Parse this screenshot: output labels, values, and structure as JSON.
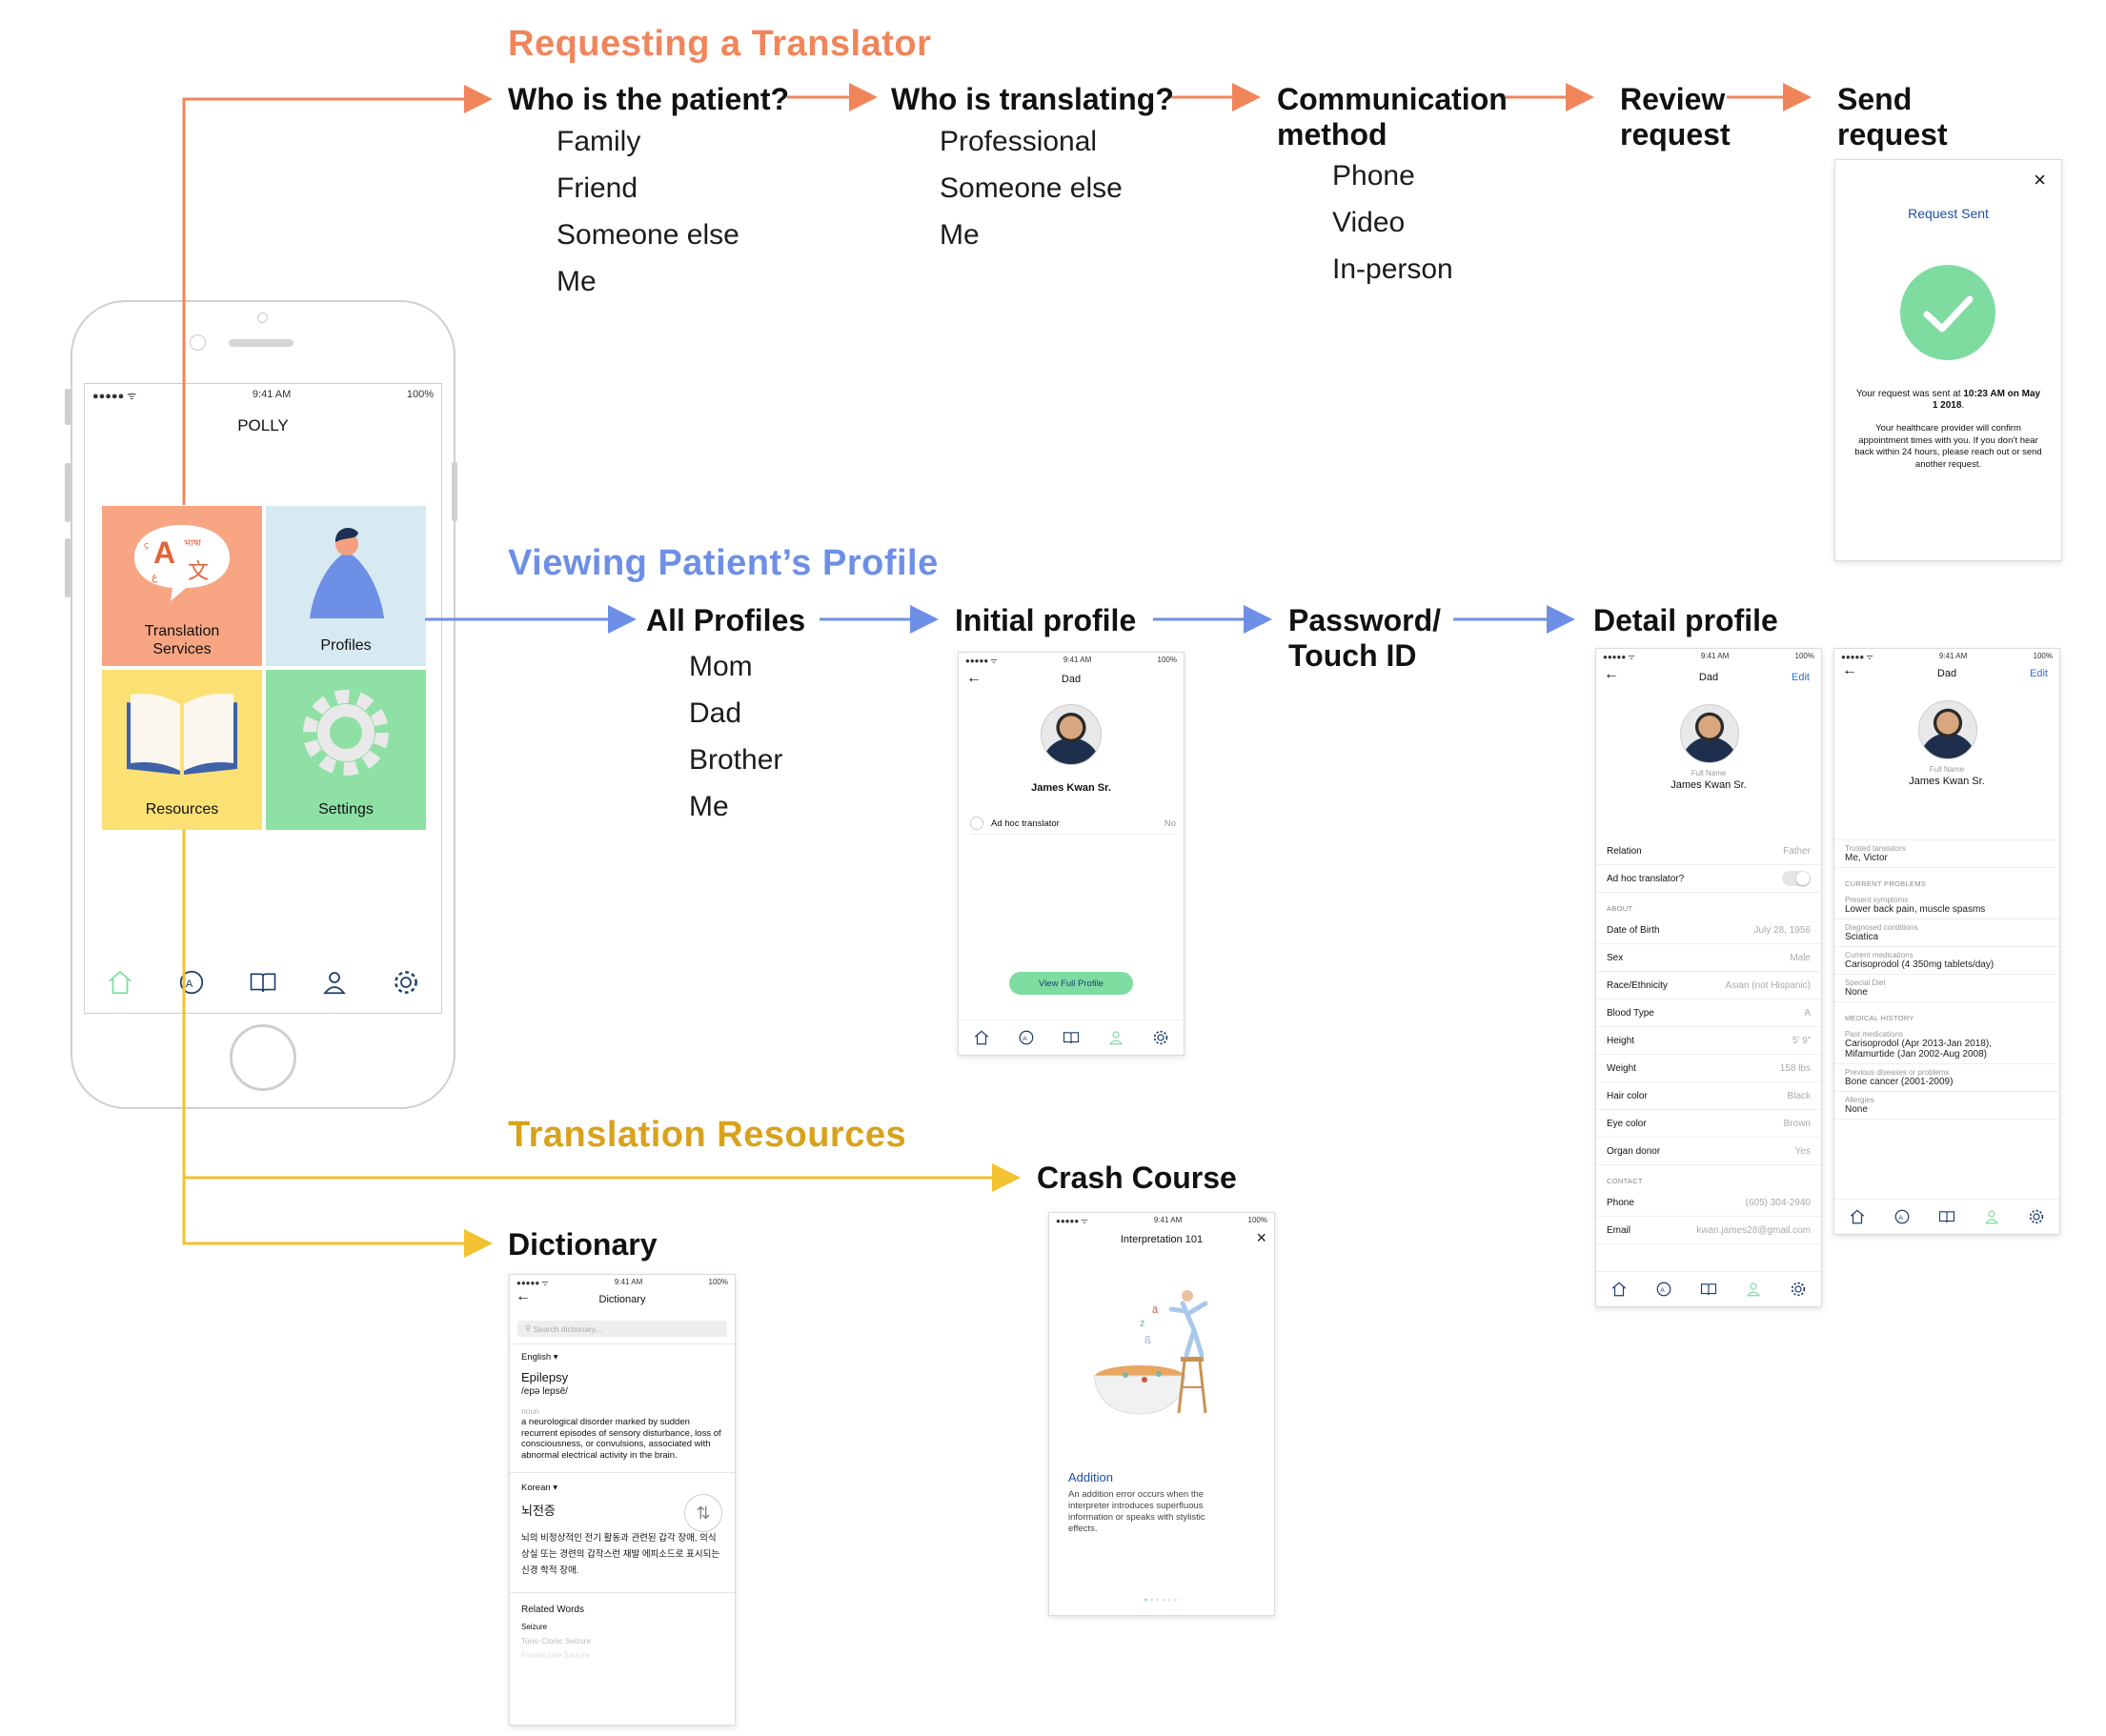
{
  "colors": {
    "orange": "#f0855c",
    "blue": "#6e8fe6",
    "gold": "#d9a21c",
    "goldline": "#f2c230",
    "tealCheck": "#7fdca1"
  },
  "request": {
    "title": "Requesting a Translator",
    "steps": [
      {
        "label": "Who is the patient?",
        "options": [
          "Family",
          "Friend",
          "Someone else",
          "Me"
        ]
      },
      {
        "label": "Who is translating?",
        "options": [
          "Professional",
          "Someone else",
          "Me"
        ]
      },
      {
        "label": "Communication\nmethod",
        "options": [
          "Phone",
          "Video",
          "In-person"
        ]
      },
      {
        "label": "Review\nrequest",
        "options": []
      },
      {
        "label": "Send\nrequest",
        "options": []
      }
    ],
    "sent": {
      "close": "×",
      "title": "Request Sent",
      "line1a": "Your request was sent at ",
      "line1b": "10:23 AM on May 1 2018",
      "line1c": ".",
      "line2": "Your healthcare provider will confirm appointment times with you. If you don’t hear back within 24 hours, please reach out or send another request."
    }
  },
  "profile": {
    "title": "Viewing Patient’s Profile",
    "steps": [
      {
        "label": "All Profiles",
        "options": [
          "Mom",
          "Dad",
          "Brother",
          "Me"
        ]
      },
      {
        "label": "Initial profile",
        "options": []
      },
      {
        "label": "Password/\nTouch ID",
        "options": []
      },
      {
        "label": "Detail profile",
        "options": []
      }
    ],
    "initial": {
      "header": "Dad",
      "name": "James Kwan Sr.",
      "adhoc": "Ad hoc translator",
      "adhoc_value": "No",
      "button": "View Full Profile"
    },
    "detail1": {
      "header": "Dad",
      "edit": "Edit",
      "fullname_label": "Full Name",
      "name": "James Kwan Sr.",
      "rows_top": [
        [
          "Relation",
          "Father"
        ],
        [
          "Ad hoc translator?",
          ""
        ]
      ],
      "about_header": "ABOUT",
      "about": [
        [
          "Date of Birth",
          "July 28, 1956"
        ],
        [
          "Sex",
          "Male"
        ],
        [
          "Race/Ethnicity",
          "Asian (not Hispanic)"
        ],
        [
          "Blood Type",
          "A"
        ],
        [
          "Height",
          "5’ 9”"
        ],
        [
          "Weight",
          "158 lbs"
        ],
        [
          "Hair color",
          "Black"
        ],
        [
          "Eye color",
          "Brown"
        ],
        [
          "Organ donor",
          "Yes"
        ]
      ],
      "contact_header": "CONTACT",
      "contact": [
        [
          "Phone",
          "(605) 304-2940"
        ],
        [
          "Email",
          "kwan.james28@gmail.com"
        ]
      ]
    },
    "detail2": {
      "header": "Dad",
      "edit": "Edit",
      "fullname_label": "Full Name",
      "name": "James Kwan Sr.",
      "trusted_label": "Trusted tanslators",
      "trusted": "Me, Victor",
      "current_header": "CURRENT PROBLEMS",
      "current": [
        [
          "Present symptoms",
          "Lower back pain, muscle spasms"
        ],
        [
          "Diagnosed conditions",
          "Sciatica"
        ],
        [
          "Current medications",
          "Carisoprodol (4 350mg tablets/day)"
        ],
        [
          "Special Diet",
          "None"
        ]
      ],
      "history_header": "MEDICAL HISTORY",
      "history": [
        [
          "Past medications",
          "Carisoprodol (Apr 2013-Jan 2018),\nMifamurtide (Jan 2002-Aug 2008)"
        ],
        [
          "Previous diseases or problems",
          "Bone cancer (2001-2009)"
        ],
        [
          "Allergies",
          "None"
        ]
      ]
    }
  },
  "resources": {
    "title": "Translation Resources",
    "crash_label": "Crash Course",
    "dict_label": "Dictionary",
    "crash": {
      "header": "Interpretation 101",
      "close": "×",
      "term": "Addition",
      "desc": "An addition error occurs when the interpreter introduces superfluous information or speaks with stylistic effects."
    },
    "dict": {
      "header": "Dictionary",
      "search_placeholder": "Search dictionary...",
      "lang1": "English",
      "word": "Epilepsy",
      "phonetic": "/epə   lepsē/",
      "pos": "noun",
      "def": "a neurological disorder marked by sudden recurrent episodes of sensory disturbance, loss of consciousness, or convulsions, associated with abnormal electrical activity in the brain.",
      "lang2": "Korean",
      "word2": "뇌전증",
      "def2": "뇌의 비정상적인 전기 활동과 관련된 갑각 장애, 의식 상실 또는 경련의 갑작스런 재발 에피소드로 표시되는 신경 학적 장애.",
      "related_title": "Related Words",
      "related": [
        "Seizure",
        "Tonic-Clonic Seizure",
        "Frontal lobe Seizure"
      ]
    }
  },
  "phone": {
    "carrier": "●●●●● ᯤ",
    "time": "9:41 AM",
    "battery": "100%",
    "app": "POLLY",
    "tiles": [
      {
        "label": "Translation\nServices",
        "color": "#f7a583"
      },
      {
        "label": "Profiles",
        "color": "#d7e9f1"
      },
      {
        "label": "Resources",
        "color": "#fbe074"
      },
      {
        "label": "Settings",
        "color": "#8ee0a5"
      }
    ]
  },
  "mini_status": {
    "carrier": "●●●●● ᯤ",
    "time": "9:41 AM",
    "battery": "100%"
  }
}
